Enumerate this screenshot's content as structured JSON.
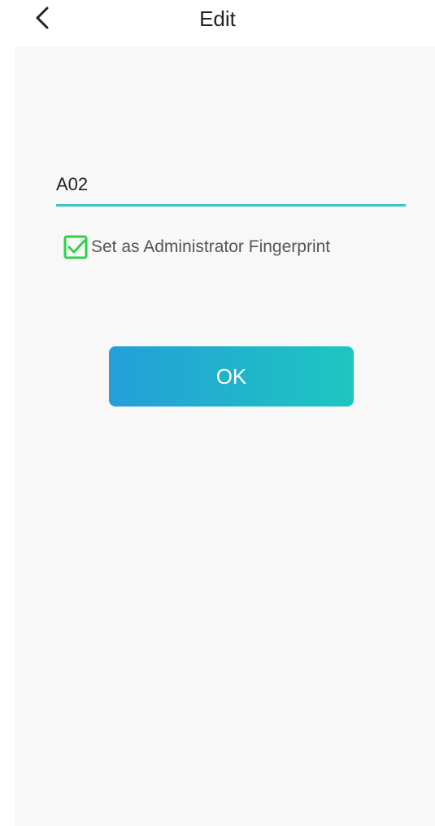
{
  "header": {
    "back_icon": "chevron-left-icon",
    "title": "Edit"
  },
  "form": {
    "name_value": "A02",
    "admin_checkbox": {
      "checked": true,
      "label": "Set as Administrator Fingerprint",
      "icon": "checkbox-checked-icon"
    },
    "ok_label": "OK"
  },
  "colors": {
    "accent_underline": "#35c6c8",
    "checkbox_green": "#2fd14a",
    "button_gradient_start": "#239fd9",
    "button_gradient_end": "#1ec6c0",
    "panel_background": "#f8f8f8"
  }
}
